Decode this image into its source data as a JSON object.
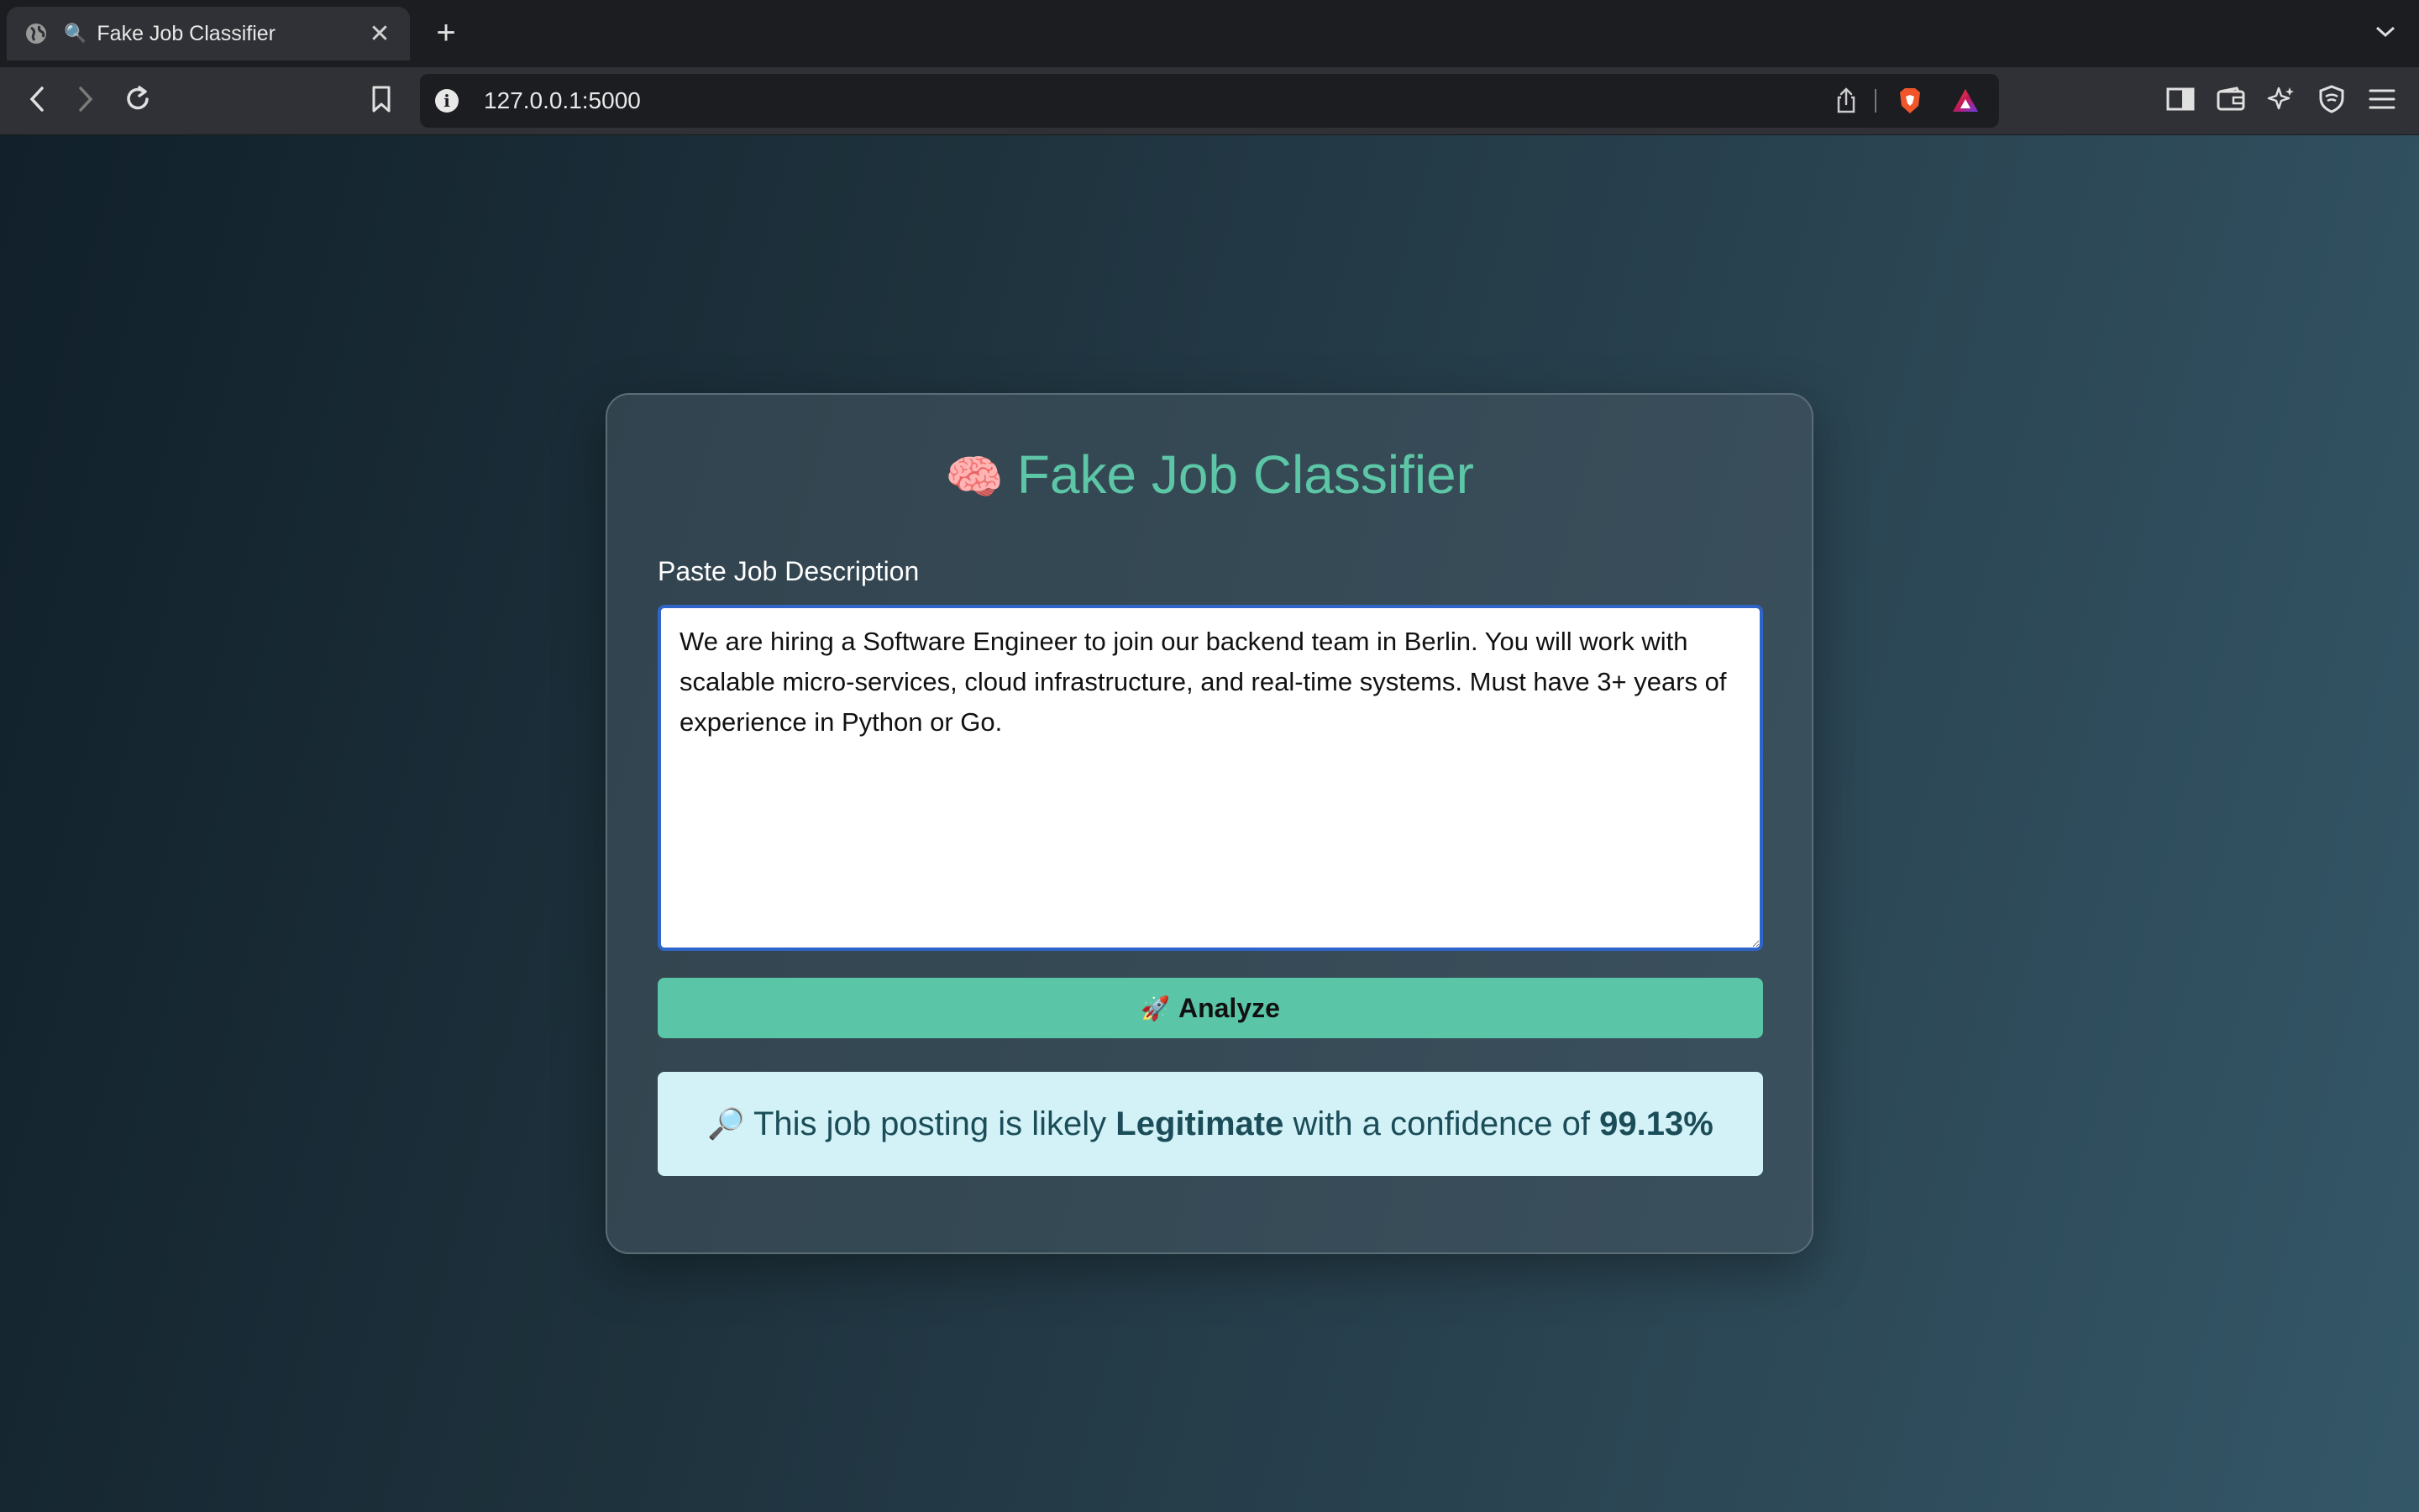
{
  "browser": {
    "tab": {
      "icon": "globe-icon",
      "emoji": "🔍",
      "title": "Fake Job Classifier",
      "close_label": "✕"
    },
    "new_tab_label": "+",
    "address": "127.0.0.1:5000"
  },
  "app": {
    "title_emoji": "🧠",
    "title": "Fake Job Classifier",
    "field_label": "Paste Job Description",
    "description_value": "We are hiring a Software Engineer to join our backend team in Berlin. You will work with scalable micro-services, cloud infrastructure, and real-time systems. Must have 3+ years of experience in Python or Go.",
    "analyze_emoji": "🚀",
    "analyze_label": "Analyze",
    "result": {
      "emoji": "🔎",
      "prefix": "This job posting is likely",
      "verdict": "Legitimate",
      "middle": "with a confidence of",
      "confidence": "99.13%"
    }
  },
  "colors": {
    "accent": "#5bc6a7",
    "result_bg": "#d3f2f8",
    "result_text": "#1b4d59",
    "focus_border": "#2f64c8"
  }
}
